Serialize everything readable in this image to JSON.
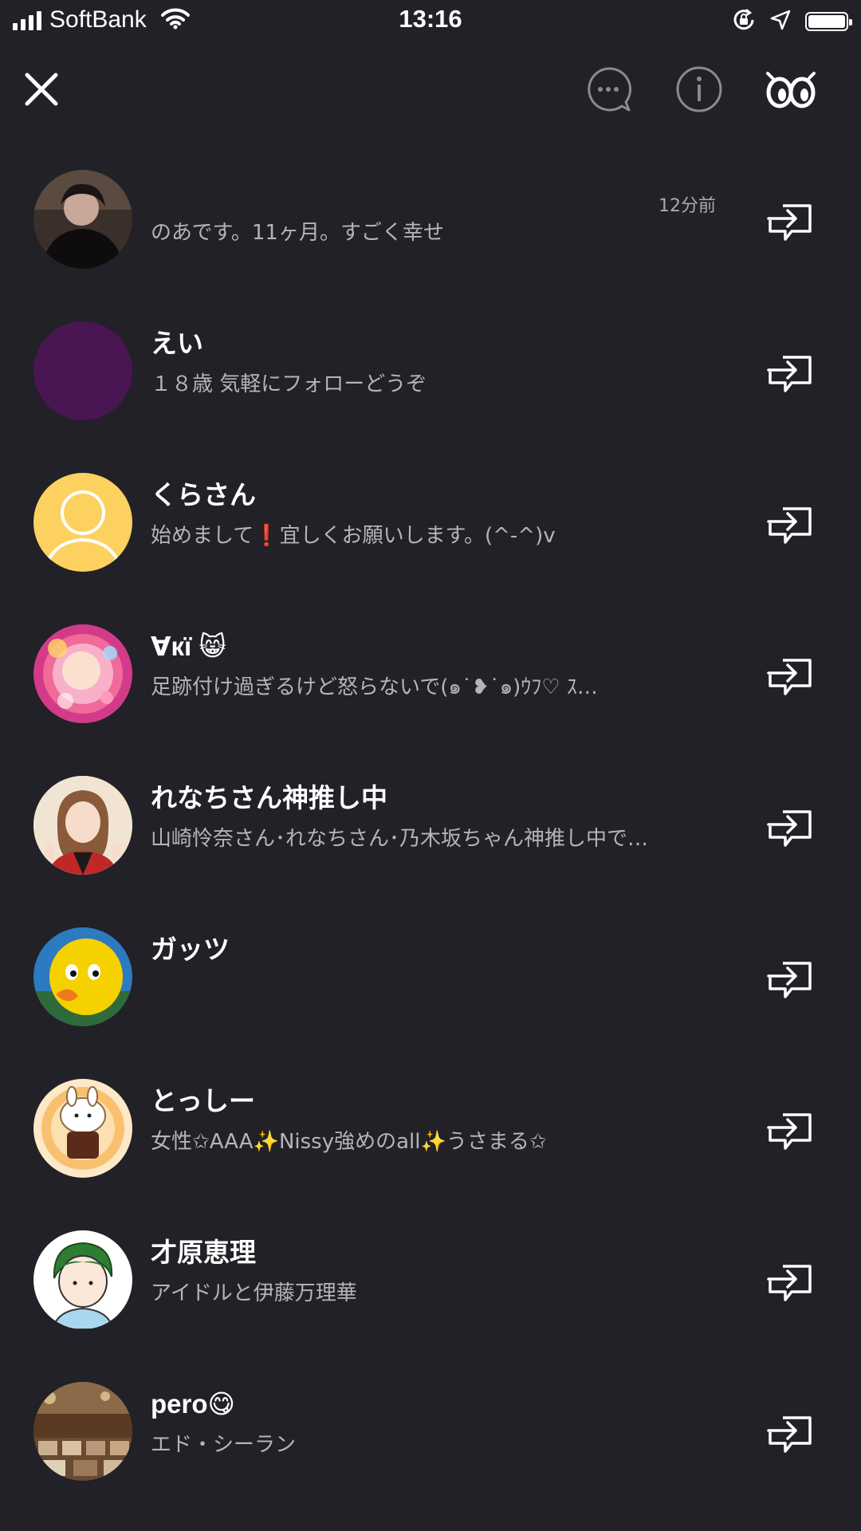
{
  "status_bar": {
    "carrier": "SoftBank",
    "time": "13:16",
    "icons": [
      "signal-icon",
      "wifi-icon",
      "orientation-lock-icon",
      "location-arrow-icon",
      "battery-icon"
    ]
  },
  "header": {
    "icons": [
      "close-icon",
      "chat-bubble-icon",
      "info-icon",
      "footprint-eyes-icon"
    ]
  },
  "users": [
    {
      "name": "",
      "bio": "のあです。11ヶ月。すごく幸せ",
      "time": "12分前",
      "avatar": "photo-dark"
    },
    {
      "name": "えい",
      "bio": "１８歳  気軽にフォローどうぞ",
      "time": "",
      "avatar": "solid-purple"
    },
    {
      "name": "くらさん",
      "bio": "始めまして❗️宜しくお願いします。(^-^)v",
      "time": "",
      "avatar": "default-silhouette"
    },
    {
      "name": "∀кï 😸",
      "bio": "足跡付け過ぎるけど怒らないで(๑˙❥˙๑)ｳﾌ♡         ｽ…",
      "time": "",
      "avatar": "photo-pink-bokeh"
    },
    {
      "name": "れなちさん神推し中",
      "bio": "山崎怜奈さん･れなちさん･乃木坂ちゃん神推し中で…",
      "time": "",
      "avatar": "photo-girl"
    },
    {
      "name": "ガッツ",
      "bio": "",
      "time": "",
      "avatar": "photo-yellow-duck"
    },
    {
      "name": "とっしー",
      "bio": "女性✩AAA✨Nissy強めのall✨うさまる✩",
      "time": "",
      "avatar": "illustration-rabbit"
    },
    {
      "name": "才原恵理",
      "bio": "アイドルと伊藤万理華",
      "time": "",
      "avatar": "illustration-boy"
    },
    {
      "name": "pero😋",
      "bio": "エド・シーラン",
      "time": "",
      "avatar": "photo-restaurant"
    }
  ],
  "colors": {
    "background": "#212127",
    "text_primary": "#ffffff",
    "text_secondary": "#b4b4ba",
    "icon_gray": "#8a8a90"
  }
}
